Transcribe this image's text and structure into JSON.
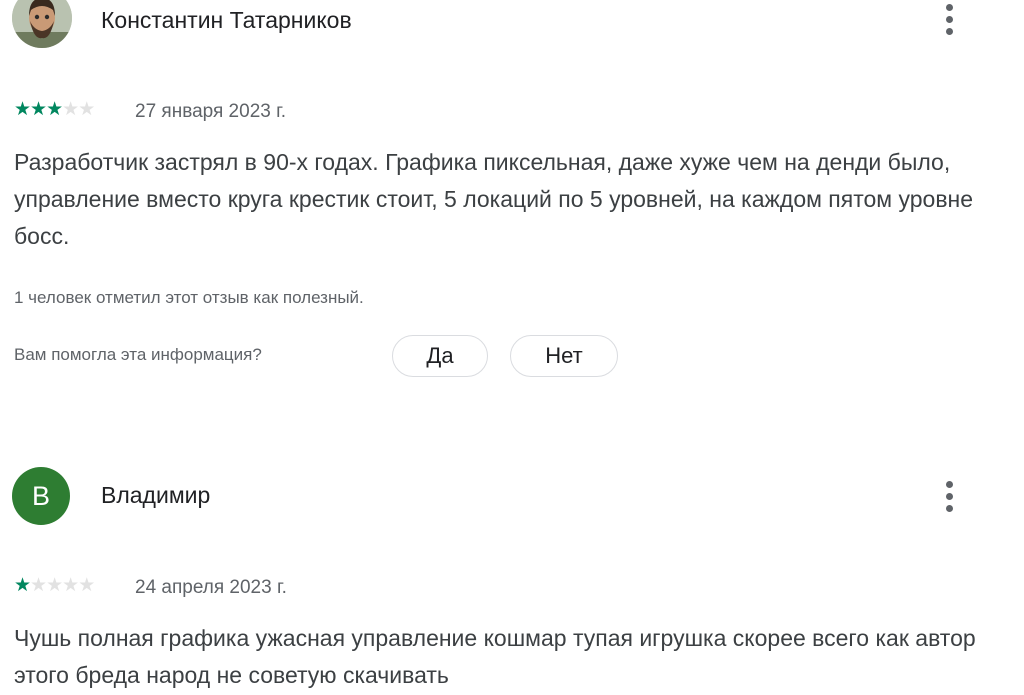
{
  "reviews": [
    {
      "author": "Константин Татарников",
      "avatar_icon": "user-photo",
      "rating": 3,
      "max_rating": 5,
      "date": "27 января 2023 г.",
      "text": "Разработчик застрял в 90-х годах. Графика пиксельная, даже хуже чем на денди было, управление вместо круга крестик стоит, 5 локаций по 5 уровней, на каждом пятом уровне босс.",
      "helpful_count_text": "1 человек отметил этот отзыв как полезный.",
      "helpful_question": "Вам помогла эта информация?",
      "yes_label": "Да",
      "no_label": "Нет"
    },
    {
      "author": "Владимир",
      "avatar_letter": "В",
      "avatar_color": "#2e7d32",
      "rating": 1,
      "max_rating": 5,
      "date": "24 апреля 2023 г.",
      "text": "Чушь полная графика ужасная управление кошмар тупая игрушка скорее всего как автор этого бреда народ не советую скачивать"
    }
  ],
  "colors": {
    "star_filled": "#01875f",
    "star_empty": "#e2e2e2",
    "accent_green": "#2e7d32"
  },
  "icons": {
    "more": "more-vert-icon",
    "star": "star-icon"
  }
}
